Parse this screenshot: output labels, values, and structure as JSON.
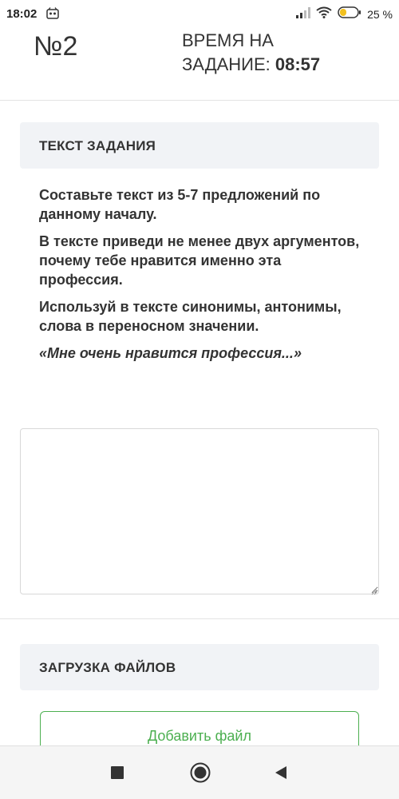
{
  "status_bar": {
    "time": "18:02",
    "battery_percent": "25 %",
    "icons": [
      "notification-app-icon",
      "signal-icon",
      "wifi-icon",
      "battery-icon"
    ]
  },
  "header": {
    "task_number": "№2",
    "timer_label_line1": "ВРЕМЯ НА",
    "timer_label_line2": "ЗАДАНИЕ: ",
    "timer_value": "08:57"
  },
  "task_section": {
    "title": "ТЕКСТ ЗАДАНИЯ",
    "paragraphs": [
      "Составьте текст из 5-7 предложений по данному началу.",
      "В тексте приведи не менее двух аргументов, почему тебе нравится именно эта профессия.",
      "Используй в тексте синонимы, антонимы, слова в переносном значении."
    ],
    "quote": "«Мне очень нравится профессия...»"
  },
  "answer": {
    "value": ""
  },
  "upload_section": {
    "title": "ЗАГРУЗКА ФАЙЛОВ",
    "add_file_label": "Добавить файл"
  },
  "nav_bar": {
    "icons": [
      "recent-apps-icon",
      "home-icon",
      "back-icon"
    ]
  },
  "colors": {
    "accent_green": "#4caf50",
    "section_bg": "#f1f3f6",
    "text": "#333333"
  }
}
